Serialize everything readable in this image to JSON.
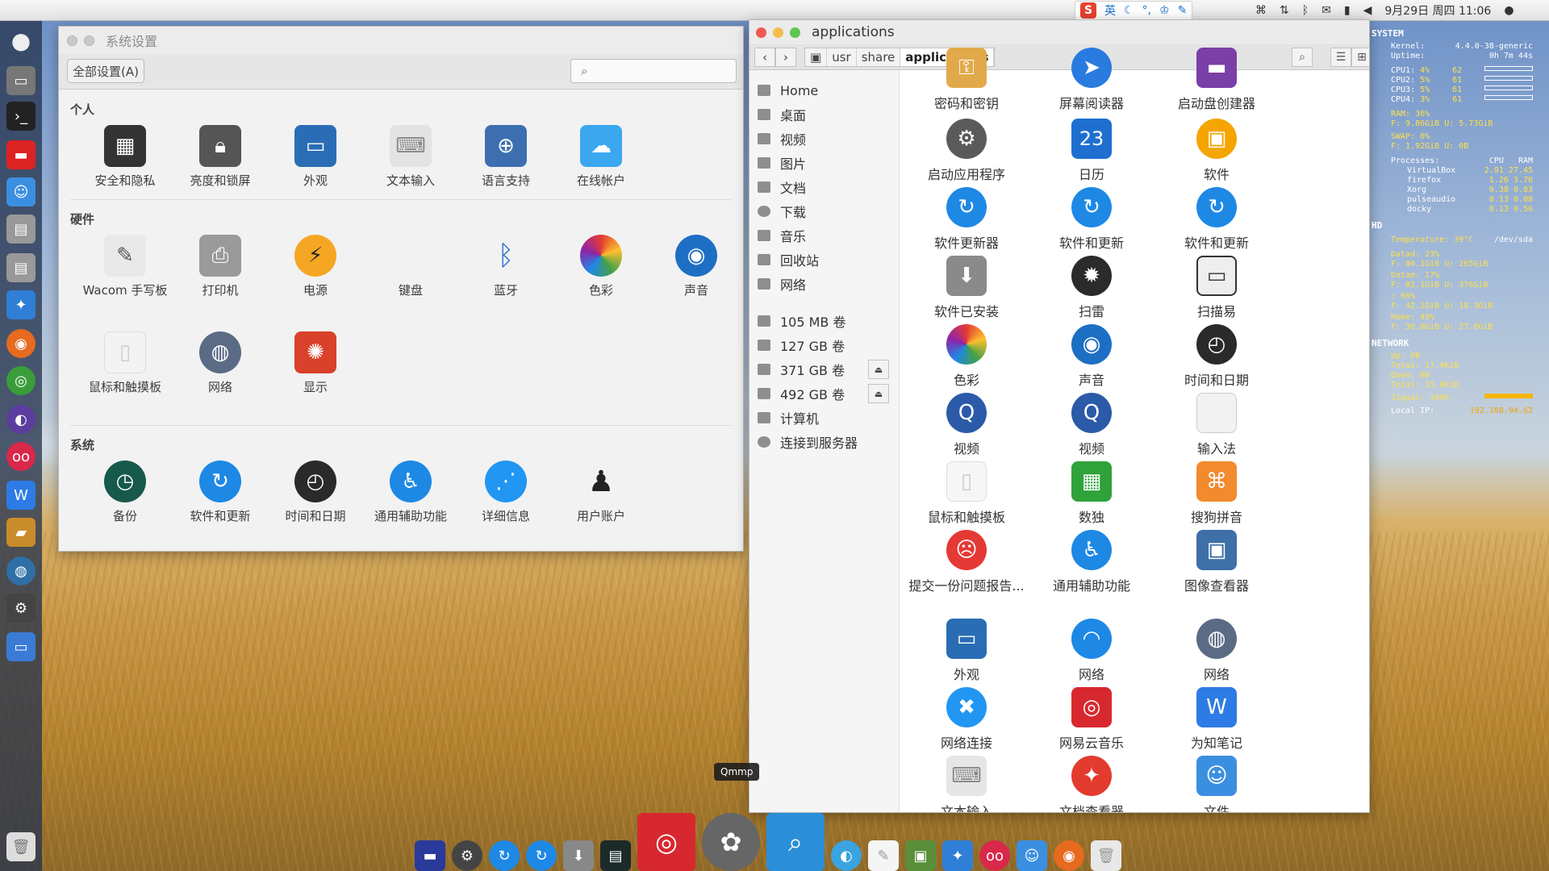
{
  "topbar": {
    "ime_label": "英",
    "datetime": "9月29日 周四 11:06"
  },
  "settings": {
    "title": "系统设置",
    "all_settings_label": "全部设置(A)",
    "search_placeholder": "",
    "sections": {
      "personal": "个人",
      "hardware": "硬件",
      "system": "系统"
    },
    "personal_items": [
      "安全和隐私",
      "亮度和锁屏",
      "外观",
      "文本输入",
      "语言支持",
      "在线帐户"
    ],
    "hardware_items": [
      "Wacom 手写板",
      "打印机",
      "电源",
      "键盘",
      "蓝牙",
      "色彩",
      "声音",
      "鼠标和触摸板",
      "网络",
      "显示"
    ],
    "system_items": [
      "备份",
      "软件和更新",
      "时间和日期",
      "通用辅助功能",
      "详细信息",
      "用户账户"
    ]
  },
  "files": {
    "title": "applications",
    "crumbs": [
      "usr",
      "share",
      "applications"
    ],
    "sidebar": [
      "Home",
      "桌面",
      "视频",
      "图片",
      "文档",
      "下载",
      "音乐",
      "回收站",
      "网络",
      "105 MB 卷",
      "127 GB 卷",
      "371 GB 卷",
      "492 GB 卷",
      "计算机",
      "连接到服务器"
    ],
    "apps": [
      "密码和密钥",
      "屏幕阅读器",
      "启动盘创建器",
      "启动应用程序",
      "日历",
      "软件",
      "软件更新器",
      "软件和更新",
      "软件和更新",
      "软件已安装",
      "扫雷",
      "扫描易",
      "色彩",
      "声音",
      "时间和日期",
      "视频",
      "视频",
      "输入法",
      "鼠标和触摸板",
      "数独",
      "搜狗拼音",
      "提交一份问题报告...",
      "通用辅助功能",
      "图像查看器",
      "外观",
      "网络",
      "网络",
      "网络连接",
      "网易云音乐",
      "为知笔记",
      "文本输入",
      "文档查看器",
      "文件"
    ],
    "calendar_day": "23"
  },
  "conky": {
    "system": "SYSTEM",
    "kernel_label": "Kernel:",
    "kernel": "4.4.0-38-generic",
    "uptime_label": "Uptime:",
    "uptime": "0h 7m 44s",
    "cpus": [
      [
        "CPU1:",
        "4%",
        "62"
      ],
      [
        "CPU2:",
        "5%",
        "61"
      ],
      [
        "CPU3:",
        "5%",
        "61"
      ],
      [
        "CPU4:",
        "3%",
        "61"
      ]
    ],
    "ram": "RAM: 36%",
    "ram_detail": "F: 9.86GiB U: 5.73GiB",
    "swap": "SWAP: 0%",
    "swap_detail": "F: 1.92GiB U: 0B",
    "processes_label": "Processes:",
    "proc_cols": [
      "CPU",
      "RAM"
    ],
    "processes": [
      [
        "VirtualBox",
        "2.91",
        "27.45"
      ],
      [
        "firefox",
        "1.26",
        "3.70"
      ],
      [
        "Xorg",
        "0.38",
        "0.83"
      ],
      [
        "pulseaudio",
        "0.13",
        "0.08"
      ],
      [
        "docky",
        "0.13",
        "0.56"
      ]
    ],
    "hd": "HD",
    "temperature": "Temperature: 39°C",
    "dev": "/dev/sda",
    "disks": [
      [
        "Datad: 23%",
        "F: 80.1GiB U: 265GiB"
      ],
      [
        "Datae: 17%",
        "F: 82.1GiB U: 376GiB"
      ],
      [
        ": 66%",
        "F: 42.1GiB U: 18.3GiB"
      ],
      [
        "Home: 49%",
        "F: 30.0GiB U: 27.0GiB"
      ]
    ],
    "network": "NETWORK",
    "up": "Up: 0B",
    "up_total": "Total: 17.4KiB",
    "down": "Down: 0B",
    "down_total": "Total: 15.8KiB",
    "signal": "Signal: 100%",
    "local_ip_label": "Local IP:",
    "local_ip": "192.168.94.62"
  },
  "dock": {
    "tooltip": "Qmmp"
  }
}
